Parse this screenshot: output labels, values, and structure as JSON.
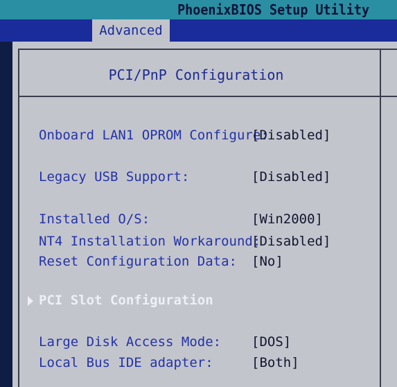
{
  "window": {
    "title": "PhoenixBIOS Setup Utility"
  },
  "menu": {
    "active_tab": "Advanced"
  },
  "panel": {
    "title": "PCI/PnP Configuration"
  },
  "settings": [
    {
      "label": "Onboard LAN1 OPROM Configure:",
      "value": "[Disabled]"
    },
    {
      "label": "Legacy USB Support:",
      "value": "[Disabled]"
    },
    {
      "label": "Installed O/S:",
      "value": "[Win2000]"
    },
    {
      "label": "NT4 Installation Workaround:",
      "value": "[Disabled]"
    },
    {
      "label": "Reset Configuration Data:",
      "value": "[No]"
    },
    {
      "label": "Large Disk Access Mode:",
      "value": "[DOS]"
    },
    {
      "label": "Local Bus IDE adapter:",
      "value": "[Both]"
    }
  ],
  "submenu": {
    "label": "PCI Slot Configuration",
    "icon": "triangle-right-icon"
  },
  "colors": {
    "title_bar": "#2a8fa3",
    "menu_bar": "#1a2b9a",
    "panel_background": "#c3c5cd",
    "label_text": "#2433a6",
    "value_text": "#11152e",
    "highlight_text": "#eef0f6"
  }
}
